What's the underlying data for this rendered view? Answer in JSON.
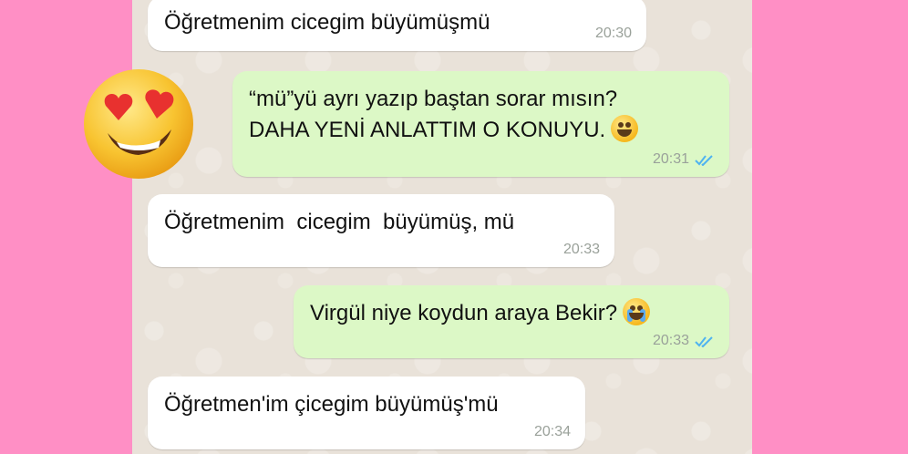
{
  "messages": [
    {
      "text": "Öğretmenim cicegim büyümüşmü",
      "time": "20:30",
      "direction": "incoming"
    },
    {
      "line1": "“mü”yü ayrı yazıp baştan sorar mısın?",
      "line2": "DAHA YENİ ANLATTIM O KONUYU.",
      "emoji": "grinning-face",
      "time": "20:31",
      "direction": "outgoing",
      "read": true
    },
    {
      "text": "Öğretmenim  cicegim  büyümüş, mü",
      "time": "20:33",
      "direction": "incoming"
    },
    {
      "text": "Virgül niye koydun araya Bekir?",
      "emoji": "crying-face",
      "time": "20:33",
      "direction": "outgoing",
      "read": true
    },
    {
      "text": "Öğretmen'im çicegim büyümüş'mü",
      "time": "20:34",
      "direction": "incoming"
    }
  ],
  "overlay_emoji": "heart-eyes-face",
  "colors": {
    "background": "#ff8fc5",
    "chat_background": "#e9e2d9",
    "incoming_bubble": "#ffffff",
    "outgoing_bubble": "#dcf8c6",
    "read_ticks": "#4fb3f0"
  }
}
